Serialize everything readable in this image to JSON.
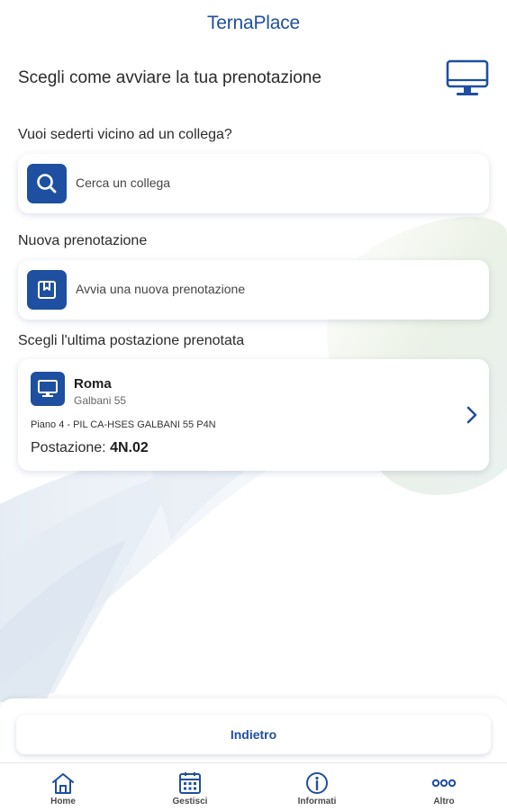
{
  "app": {
    "logo_text": "TernaPlace"
  },
  "header": {
    "title": "Scegli come avviare la tua prenotazione",
    "icon": "monitor-icon"
  },
  "colleague_section": {
    "label": "Vuoi sederti vicino ad un collega?",
    "action_label": "Cerca un collega",
    "icon": "search-icon"
  },
  "new_booking_section": {
    "label": "Nuova prenotazione",
    "action_label": "Avvia una nuova prenotazione",
    "icon": "bookmark-icon"
  },
  "last_booking_section": {
    "label": "Scegli l'ultima postazione prenotata",
    "city": "Roma",
    "address": "Galbani 55",
    "floor": "Piano 4 - PIL CA-HSES GALBANI 55 P4N",
    "seat_label": "Postazione:",
    "seat_code": "4N.02",
    "icon": "desktop-icon"
  },
  "footer": {
    "back_label": "Indietro"
  },
  "nav": {
    "items": [
      {
        "label": "Home",
        "icon": "home-icon"
      },
      {
        "label": "Gestisci",
        "icon": "calendar-icon"
      },
      {
        "label": "Informati",
        "icon": "info-icon"
      },
      {
        "label": "Altro",
        "icon": "more-icon"
      }
    ]
  },
  "colors": {
    "brand": "#1f4fa0",
    "text": "#2b2b2b",
    "card_bg": "#ffffff"
  }
}
